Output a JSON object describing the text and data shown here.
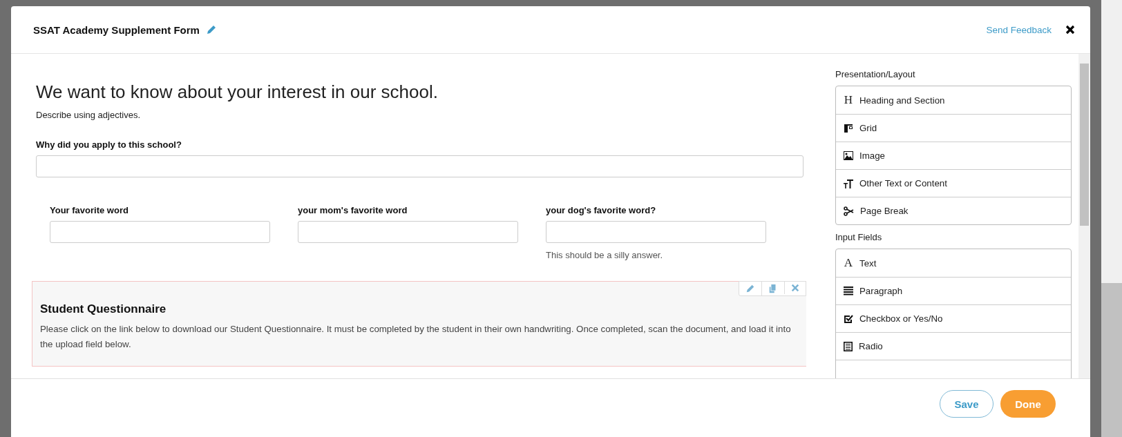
{
  "modal": {
    "title": "SSAT Academy Supplement Form",
    "feedback_link": "Send Feedback"
  },
  "form": {
    "heading": "We want to know about your interest in our school.",
    "subheading": "Describe using adjectives.",
    "question": {
      "label": "Why did you apply to this school?"
    },
    "grid_fields": [
      {
        "label": "Your favorite word"
      },
      {
        "label": "your mom's favorite word"
      },
      {
        "label": "your dog's favorite word?",
        "help": "This should be a silly answer."
      }
    ],
    "section": {
      "title": "Student Questionnaire",
      "body": "Please click on the link below to download our Student Questionnaire. It must be completed by the student in their own handwriting. Once completed, scan the document, and load it into the upload field below."
    }
  },
  "palette": [
    {
      "title": "Presentation/Layout",
      "items": [
        {
          "kind": "heading",
          "glyph": "H",
          "label": "Heading and Section"
        },
        {
          "kind": "grid",
          "label": "Grid"
        },
        {
          "kind": "image",
          "label": "Image"
        },
        {
          "kind": "other-text",
          "label": "Other Text or Content"
        },
        {
          "kind": "page-break",
          "label": "Page Break"
        }
      ]
    },
    {
      "title": "Input Fields",
      "items": [
        {
          "kind": "text",
          "glyph": "A",
          "label": "Text"
        },
        {
          "kind": "paragraph",
          "label": "Paragraph"
        },
        {
          "kind": "checkbox",
          "label": "Checkbox or Yes/No"
        },
        {
          "kind": "radio",
          "label": "Radio"
        },
        {
          "kind": "cut"
        }
      ]
    }
  ],
  "footer": {
    "buttons": [
      {
        "label": "Save",
        "kind": "secondary"
      },
      {
        "label": "Done",
        "kind": "primary"
      }
    ]
  }
}
